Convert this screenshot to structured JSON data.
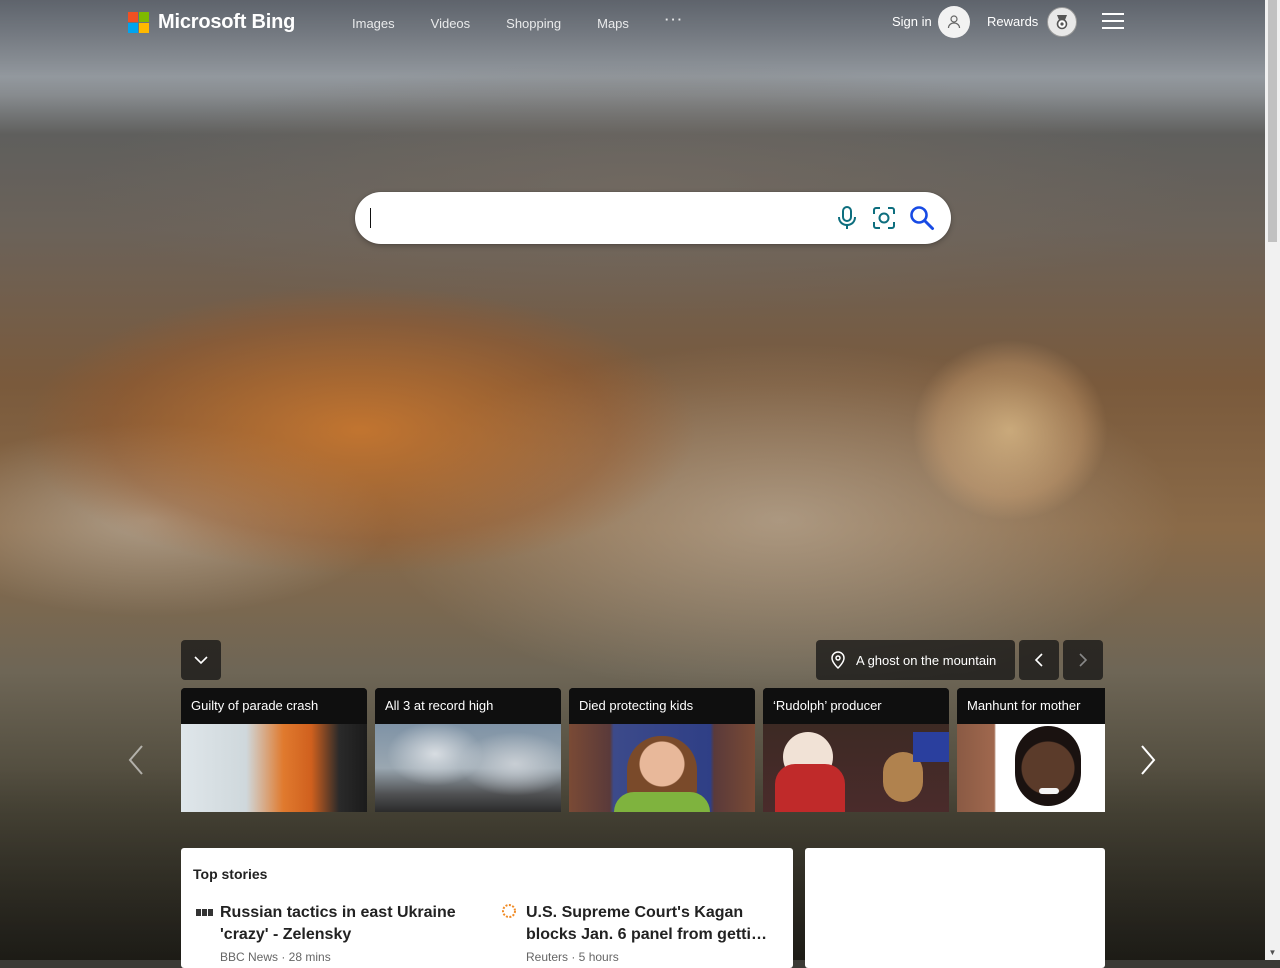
{
  "header": {
    "brand": "Microsoft Bing",
    "nav": [
      {
        "label": "Images"
      },
      {
        "label": "Videos"
      },
      {
        "label": "Shopping"
      },
      {
        "label": "Maps"
      },
      {
        "label": "···"
      }
    ],
    "sign_in": "Sign in",
    "rewards": "Rewards"
  },
  "search": {
    "value": "",
    "placeholder": ""
  },
  "background": {
    "caption": "A ghost on the mountain"
  },
  "news_cards": [
    {
      "title": "Guilty of parade crash"
    },
    {
      "title": "All 3 at record high"
    },
    {
      "title": "Died protecting kids"
    },
    {
      "title": "‘Rudolph’ producer"
    },
    {
      "title": "Manhunt for mother"
    }
  ],
  "top_stories": {
    "heading": "Top stories",
    "items": [
      {
        "title": "Russian tactics in east Ukraine 'crazy' - Zelensky",
        "source": "BBC News",
        "time": "28 mins",
        "meta": "BBC News · 28 mins"
      },
      {
        "title": "U.S. Supreme Court's Kagan blocks Jan. 6 panel from getti…",
        "source": "Reuters",
        "time": "5 hours",
        "meta": "Reuters · 5 hours"
      }
    ]
  },
  "colors": {
    "ms_red": "#f25022",
    "ms_green": "#7fba00",
    "ms_blue": "#00a4ef",
    "ms_yellow": "#ffb900",
    "search_icon_blue": "#174ae4",
    "lens_teal": "#0d7c8c"
  },
  "icons": [
    "microsoft-logo-icon",
    "user-icon",
    "rewards-medal-icon",
    "hamburger-menu-icon",
    "microphone-icon",
    "visual-search-icon",
    "search-icon",
    "chevron-down-icon",
    "location-pin-icon",
    "chevron-left-icon",
    "chevron-right-icon"
  ]
}
